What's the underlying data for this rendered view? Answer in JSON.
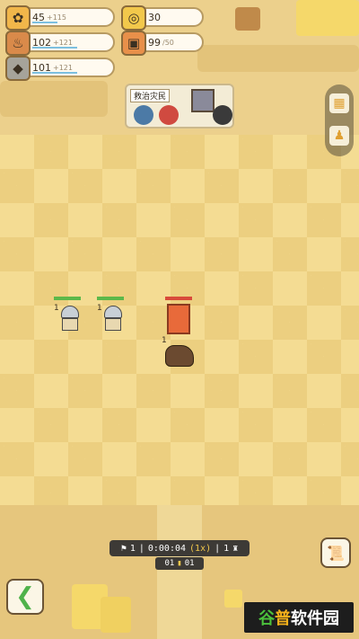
{
  "resources": [
    {
      "name": "wheat",
      "icon": "wheat-icon",
      "glyph": "✿",
      "color": "#f1b64a",
      "value": "45",
      "rate": "+115",
      "fill": 0.3
    },
    {
      "name": "meat",
      "icon": "meat-icon",
      "glyph": "♨",
      "color": "#d98a4a",
      "value": "102",
      "rate": "+121",
      "fill": 0.55
    },
    {
      "name": "stone",
      "icon": "stone-icon",
      "glyph": "◆",
      "color": "#a6a39a",
      "value": "101",
      "rate": "+121",
      "fill": 0.55
    },
    {
      "name": "coin",
      "icon": "coin-icon",
      "glyph": "◎",
      "color": "#f2c84b",
      "value": "30"
    },
    {
      "name": "population",
      "icon": "gift-icon",
      "glyph": "▣",
      "color": "#e8904a",
      "value": "99",
      "max": "/50"
    }
  ],
  "mission": {
    "label": "救治灾民"
  },
  "units": [
    {
      "level": "1",
      "type": "knight",
      "hp": 1.0
    },
    {
      "level": "1",
      "type": "knight",
      "hp": 1.0
    },
    {
      "level": "1",
      "type": "boar",
      "hp": 1.0
    }
  ],
  "hud": {
    "count_left": "1",
    "timer": "0:00:04",
    "speed": "(1x)",
    "count_right": "1",
    "wave": "01",
    "wave_total": "01"
  },
  "watermark": {
    "g1": "谷",
    "g2": "普",
    "rest": "软件园"
  }
}
